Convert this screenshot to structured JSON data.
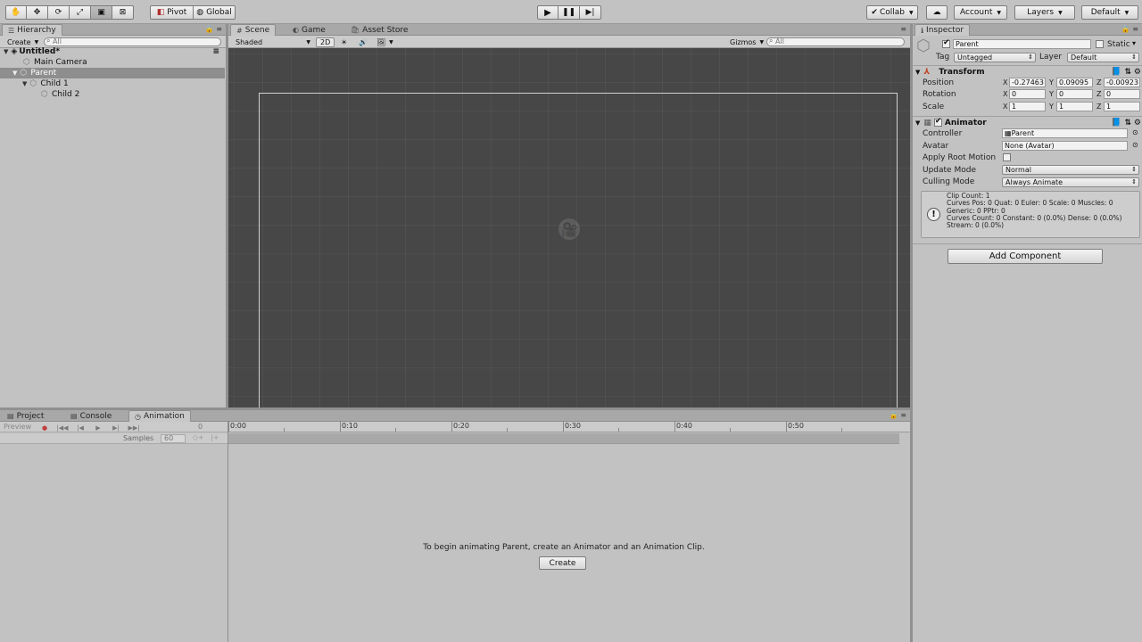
{
  "toolbar": {
    "pivot": "Pivot",
    "global": "Global",
    "collab": "Collab",
    "account": "Account",
    "layers": "Layers",
    "layout": "Default",
    "tools": [
      "hand-icon",
      "move-icon",
      "rotate-icon",
      "scale-icon",
      "rect-icon",
      "transform-icon"
    ]
  },
  "hierarchy": {
    "tab": "Hierarchy",
    "create": "Create",
    "search_placeholder": "All",
    "scene_name": "Untitled*",
    "items": {
      "main_camera": "Main Camera",
      "parent": "Parent",
      "child1": "Child 1",
      "child2": "Child 2"
    }
  },
  "scene": {
    "tabs": {
      "scene": "Scene",
      "game": "Game",
      "asset_store": "Asset Store"
    },
    "shading": "Shaded",
    "mode_2d": "2D",
    "gizmos": "Gizmos",
    "search_placeholder": "All"
  },
  "inspector": {
    "tab": "Inspector",
    "object_name": "Parent",
    "static_label": "Static",
    "tag_label": "Tag",
    "tag_value": "Untagged",
    "layer_label": "Layer",
    "layer_value": "Default",
    "transform": {
      "title": "Transform",
      "position_label": "Position",
      "rotation_label": "Rotation",
      "scale_label": "Scale",
      "axes": {
        "x": "X",
        "y": "Y",
        "z": "Z"
      },
      "position": [
        "-0.27463",
        "0.09095",
        "-0.00923"
      ],
      "rotation": [
        "0",
        "0",
        "0"
      ],
      "scale": [
        "1",
        "1",
        "1"
      ]
    },
    "animator": {
      "title": "Animator",
      "controller_label": "Controller",
      "controller_value": "Parent",
      "avatar_label": "Avatar",
      "avatar_value": "None (Avatar)",
      "root_motion_label": "Apply Root Motion",
      "update_mode_label": "Update Mode",
      "update_mode_value": "Normal",
      "culling_mode_label": "Culling Mode",
      "culling_mode_value": "Always Animate",
      "info_lines": [
        "Clip Count: 1",
        "Curves Pos: 0 Quat: 0 Euler: 0 Scale: 0 Muscles: 0",
        "Generic: 0 PPtr: 0",
        "Curves Count: 0 Constant: 0 (0.0%) Dense: 0 (0.0%)",
        "Stream: 0 (0.0%)"
      ]
    },
    "add_component": "Add Component"
  },
  "bottom": {
    "tabs": {
      "project": "Project",
      "console": "Console",
      "animation": "Animation"
    },
    "preview": "Preview",
    "frame": "0",
    "samples_label": "Samples",
    "samples_value": "60",
    "timeline_ticks": [
      "0:00",
      "0:10",
      "0:20",
      "0:30",
      "0:40",
      "0:50"
    ],
    "message": "To begin animating Parent, create an Animator and an Animation Clip.",
    "create_button": "Create"
  }
}
